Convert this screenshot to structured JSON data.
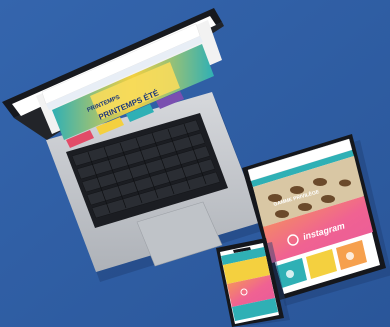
{
  "laptop": {
    "brand_text": "PRINTEMPS",
    "banner_text": "PRINTEMPS ÉTÉ"
  },
  "tablet": {
    "gamme_text": "GAMME PRIVILÈGE",
    "instagram_text": "instagram"
  },
  "colors": {
    "background": "#2f5fa6",
    "banner_yellow": "#f4d03f",
    "banner_teal": "#2fb0b5",
    "insta_pink": "#f06292",
    "insta_orange": "#f6a04d",
    "device_dark": "#15171c",
    "laptop_silver": "#c5c8cd"
  }
}
